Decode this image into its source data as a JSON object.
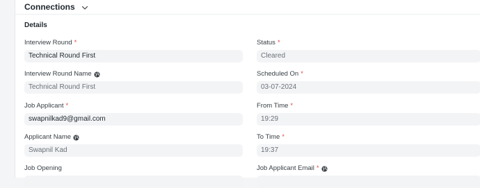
{
  "section": {
    "label": "Connections",
    "icon": "chevron-down-icon"
  },
  "details": {
    "title": "Details",
    "left": [
      {
        "label": "Interview Round",
        "required": "*",
        "globe": false,
        "value": "Technical Round First",
        "style": "dark"
      },
      {
        "label": "Interview Round Name",
        "required": "",
        "globe": true,
        "value": "Technical Round First",
        "style": "muted"
      },
      {
        "label": "Job Applicant",
        "required": "*",
        "globe": false,
        "value": "swapnilkad9@gmail.com",
        "style": "dark"
      },
      {
        "label": "Applicant Name",
        "required": "",
        "globe": true,
        "value": "Swapnil Kad",
        "style": "muted"
      },
      {
        "label": "Job Opening",
        "required": "",
        "globe": false,
        "value": "",
        "style": "dark"
      }
    ],
    "right": [
      {
        "label": "Status",
        "required": "*",
        "globe": false,
        "value": "Cleared",
        "style": "muted"
      },
      {
        "label": "Scheduled On",
        "required": "*",
        "globe": false,
        "value": "03-07-2024",
        "style": "muted"
      },
      {
        "label": "From Time",
        "required": "*",
        "globe": false,
        "value": "19:29",
        "style": "muted"
      },
      {
        "label": "To Time",
        "required": "*",
        "globe": false,
        "value": "19:37",
        "style": "muted"
      },
      {
        "label": "Job Applicant Email",
        "required": "*",
        "globe": true,
        "value": "",
        "style": "muted"
      }
    ]
  },
  "colors": {
    "required": "#e24c4c",
    "input_bg": "#f3f4f6",
    "text": "#1f272e",
    "muted": "#6b7178"
  }
}
